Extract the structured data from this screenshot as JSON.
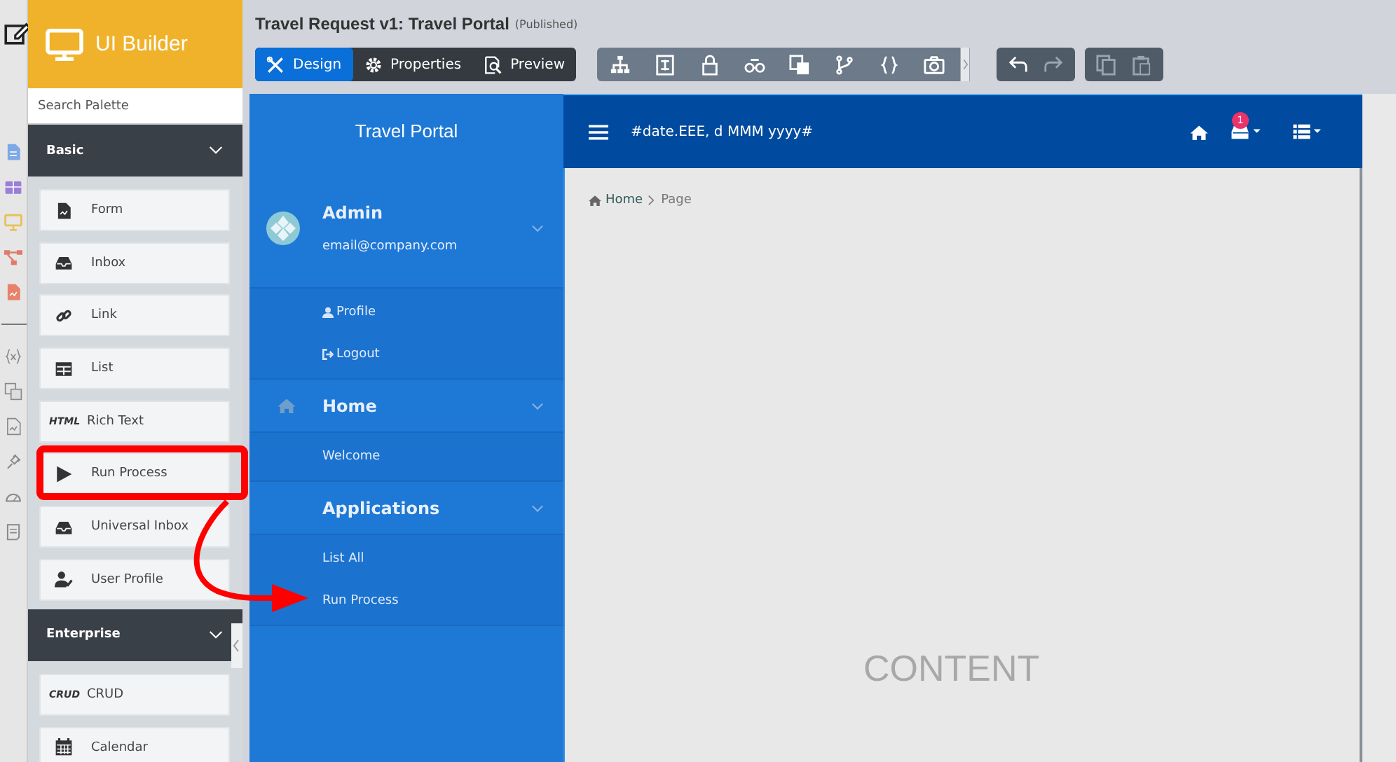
{
  "app": {
    "title": "UI Builder"
  },
  "page_title": {
    "title": "Travel Request v1: Travel Portal",
    "status": "(Published)"
  },
  "mode_tabs": [
    {
      "label": "Design",
      "selected": true
    },
    {
      "label": "Properties",
      "selected": false
    },
    {
      "label": "Preview",
      "selected": false
    }
  ],
  "palette": {
    "search": {
      "placeholder": "Search Palette"
    },
    "sections": [
      {
        "label": "Basic",
        "expanded": true,
        "items": [
          {
            "label": "Form"
          },
          {
            "label": "Inbox"
          },
          {
            "label": "Link"
          },
          {
            "label": "List"
          },
          {
            "label": "Rich Text",
            "icon_text": "HTML"
          },
          {
            "label": "Run Process"
          },
          {
            "label": "Universal Inbox"
          },
          {
            "label": "User Profile"
          }
        ]
      },
      {
        "label": "Enterprise",
        "expanded": true,
        "items": [
          {
            "label": "CRUD",
            "icon_text": "CRUD"
          },
          {
            "label": "Calendar"
          }
        ]
      }
    ]
  },
  "portal": {
    "title": "Travel Portal",
    "date_format": "#date.EEE, d MMM yyyy#",
    "notification_count": "1",
    "user": {
      "name": "Admin",
      "email": "email@company.com",
      "expanded": true,
      "children": [
        {
          "label": "Profile"
        },
        {
          "label": "Logout"
        }
      ]
    },
    "menu": [
      {
        "label": "Home",
        "expanded": true,
        "children": [
          {
            "label": "Welcome"
          }
        ]
      },
      {
        "label": "Applications",
        "expanded": true,
        "children": [
          {
            "label": "List All"
          },
          {
            "label": "Run Process"
          }
        ]
      }
    ],
    "breadcrumb": [
      {
        "label": "Home",
        "kind": "link"
      },
      {
        "label": "Page",
        "kind": "current"
      }
    ],
    "content_placeholder": "CONTENT"
  }
}
